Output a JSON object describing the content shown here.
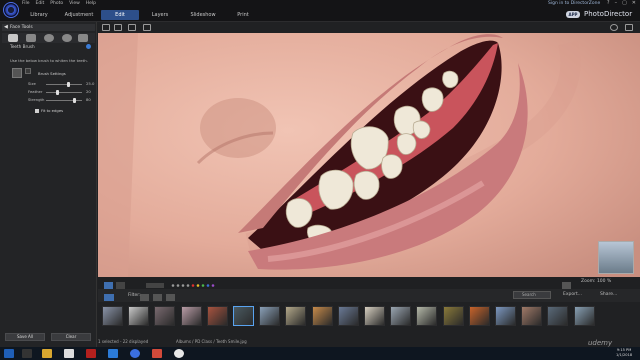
{
  "titlebar": {
    "menu": [
      "File",
      "Edit",
      "Photo",
      "View",
      "Help"
    ],
    "login": "Sign in to DirectorZone",
    "controls": [
      "?",
      "–",
      "▢",
      "✕"
    ]
  },
  "modes": [
    {
      "label": "Library",
      "active": false
    },
    {
      "label": "Adjustment",
      "active": false
    },
    {
      "label": "Edit",
      "active": true
    },
    {
      "label": "Layers",
      "active": false
    },
    {
      "label": "Slideshow",
      "active": false
    },
    {
      "label": "Print",
      "active": false
    }
  ],
  "brand": {
    "app_tag": "APP",
    "name": "PhotoDirector"
  },
  "panel": {
    "header": "Face Tools",
    "tool_label": "Teeth Brush",
    "instruction": "Use the below brush to whiten the teeth.",
    "brush_settings": "Brush Settings",
    "sliders": [
      {
        "label": "Size",
        "value": "25.0",
        "fraction": 0.62
      },
      {
        "label": "Feather",
        "value": "20",
        "fraction": 0.33
      },
      {
        "label": "Strength",
        "value": "80",
        "fraction": 0.8
      }
    ],
    "fit_edges": "Fit to edges",
    "save_button": "Save All",
    "clear_button": "Clear"
  },
  "viewbar": {
    "zoom_label": "Zoom:",
    "zoom_value": "100 %"
  },
  "filterbar": {
    "filter_label": "Filter:",
    "search_placeholder": "Search",
    "export_label": "Export...",
    "share_label": "Share..."
  },
  "thumbnails": [
    {
      "color": "#8a94a8",
      "selected": false
    },
    {
      "color": "#c9c9c9",
      "selected": false
    },
    {
      "color": "#7a6a70",
      "selected": false
    },
    {
      "color": "#b99ca6",
      "selected": false
    },
    {
      "color": "#a8533f",
      "selected": false
    },
    {
      "color": "#4a5a62",
      "selected": true
    },
    {
      "color": "#8aa0b8",
      "selected": false
    },
    {
      "color": "#b3a88a",
      "selected": false
    },
    {
      "color": "#c68a4a",
      "selected": false
    },
    {
      "color": "#6a7a96",
      "selected": false
    },
    {
      "color": "#d6cfc0",
      "selected": false
    },
    {
      "color": "#9aa6b2",
      "selected": false
    },
    {
      "color": "#b4b8a8",
      "selected": false
    },
    {
      "color": "#8a7a3a",
      "selected": false
    },
    {
      "color": "#c8632a",
      "selected": false
    },
    {
      "color": "#7c98c0",
      "selected": false
    },
    {
      "color": "#a07a68",
      "selected": false
    },
    {
      "color": "#5a6a7a",
      "selected": false
    },
    {
      "color": "#88a0b4",
      "selected": false
    }
  ],
  "status": {
    "count": "1 selected - 22 displayed",
    "path": "Albums / PD Class / Teeth Smile.jpg"
  },
  "watermark": "udemy",
  "clock": {
    "time": "9:15 PM",
    "date": "1/1/2018"
  },
  "colors": {
    "accent": "#2d4f8a",
    "selection": "#59a3f0"
  }
}
